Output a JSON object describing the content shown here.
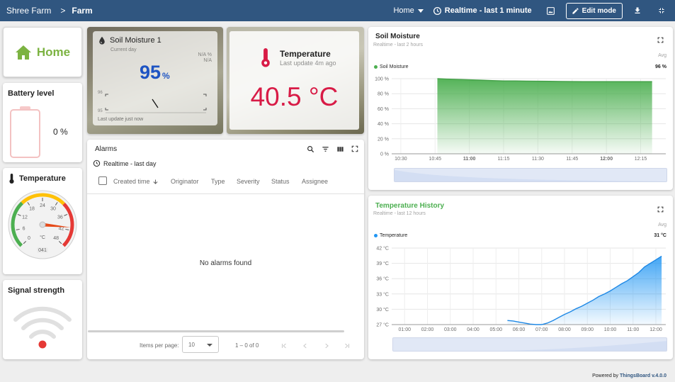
{
  "topbar": {
    "breadcrumb_root": "Shree Farm",
    "breadcrumb_sep": ">",
    "breadcrumb_current": "Farm",
    "state_select": "Home",
    "timewindow": "Realtime - last 1 minute",
    "edit_mode": "Edit mode"
  },
  "home": {
    "label": "Home"
  },
  "battery": {
    "title": "Battery level",
    "value": "0 %",
    "level": 0
  },
  "soil_card": {
    "title": "Soil Moisture 1",
    "subtitle": "Current day",
    "value": "95",
    "unit": "%",
    "na1": "N/A %",
    "na2": "N/A",
    "scale_top": "96",
    "scale_bottom": "95",
    "footer": "Last update just now"
  },
  "temp_card": {
    "title": "Temperature",
    "subtitle": "Last update 4m ago",
    "value": "40.5 °C"
  },
  "gauge": {
    "title": "Temperature",
    "ticks": [
      "0",
      "6",
      "12",
      "18",
      "24",
      "30",
      "36",
      "42",
      "48"
    ],
    "unit": "°C",
    "value_label": "041",
    "value": 41,
    "min": 0,
    "max": 48
  },
  "signal": {
    "title": "Signal strength"
  },
  "alarms": {
    "title": "Alarms",
    "timewindow": "Realtime - last day",
    "columns": [
      "Created time",
      "Originator",
      "Type",
      "Severity",
      "Status",
      "Assignee"
    ],
    "empty": "No alarms found",
    "items_per_page_label": "Items per page:",
    "items_per_page": "10",
    "range": "1 – 0 of 0"
  },
  "soil_chart": {
    "title": "Soil Moisture",
    "subtitle": "Realtime - last 2 hours",
    "agg": "Avg",
    "legend": "Soil Moisture",
    "legend_value": "96 %"
  },
  "temp_chart": {
    "title": "Temperature History",
    "subtitle": "Realtime - last 12 hours",
    "agg": "Avg",
    "legend": "Temperature",
    "legend_value": "31 °C"
  },
  "footer": {
    "prefix": "Powered by",
    "brand": "ThingsBoard v.4.0.0"
  },
  "colors": {
    "topbar": "#305680",
    "home_green": "#7cb342",
    "accent_blue": "#1e54c3",
    "temp_red": "#d81b46",
    "soil_green": "#4caf50",
    "temp_blue": "#2196f3"
  },
  "chart_data": [
    {
      "type": "area",
      "title": "Soil Moisture",
      "x": [
        "10:46",
        "10:50",
        "10:55",
        "11:00",
        "11:05",
        "11:10",
        "11:15",
        "11:20",
        "11:25",
        "11:30",
        "11:35",
        "11:40",
        "11:45",
        "11:50",
        "11:55",
        "12:00",
        "12:05",
        "12:10",
        "12:15",
        "12:20"
      ],
      "series": [
        {
          "name": "Soil Moisture",
          "values": [
            100,
            99.5,
            99,
            98.5,
            98,
            97.5,
            97,
            97,
            96.8,
            96.6,
            96.5,
            96.3,
            96.2,
            96,
            96,
            96,
            96,
            96,
            96,
            96
          ]
        }
      ],
      "xticks": [
        "10:30",
        "10:45",
        "11:00",
        "11:15",
        "11:30",
        "11:45",
        "12:00",
        "12:15"
      ],
      "yticks": [
        "0 %",
        "20 %",
        "40 %",
        "60 %",
        "80 %",
        "100 %"
      ],
      "ylim": [
        0,
        100
      ],
      "grid": true,
      "legend": "top-left"
    },
    {
      "type": "area",
      "title": "Temperature History",
      "x": [
        "05:30",
        "05:45",
        "06:00",
        "06:15",
        "06:30",
        "06:45",
        "07:00",
        "07:15",
        "07:30",
        "07:45",
        "08:00",
        "08:15",
        "08:30",
        "08:45",
        "09:00",
        "09:15",
        "09:30",
        "09:45",
        "10:00",
        "10:15",
        "10:30",
        "10:45",
        "11:00",
        "11:15",
        "11:30",
        "11:45",
        "12:00",
        "12:15"
      ],
      "series": [
        {
          "name": "Temperature",
          "values": [
            27.8,
            27.7,
            27.5,
            27.3,
            27.1,
            27.0,
            27.0,
            27.3,
            27.8,
            28.4,
            29.0,
            29.5,
            30.1,
            30.6,
            31.2,
            31.8,
            32.5,
            33.0,
            33.6,
            34.3,
            35.0,
            35.6,
            36.4,
            37.2,
            38.3,
            39.0,
            39.7,
            40.4
          ]
        }
      ],
      "xticks": [
        "01:00",
        "02:00",
        "03:00",
        "04:00",
        "05:00",
        "06:00",
        "07:00",
        "08:00",
        "09:00",
        "10:00",
        "11:00",
        "12:00"
      ],
      "yticks": [
        "27 °C",
        "30 °C",
        "33 °C",
        "36 °C",
        "39 °C",
        "42 °C"
      ],
      "ylim": [
        27,
        42
      ],
      "grid": true,
      "legend": "top-left"
    }
  ]
}
